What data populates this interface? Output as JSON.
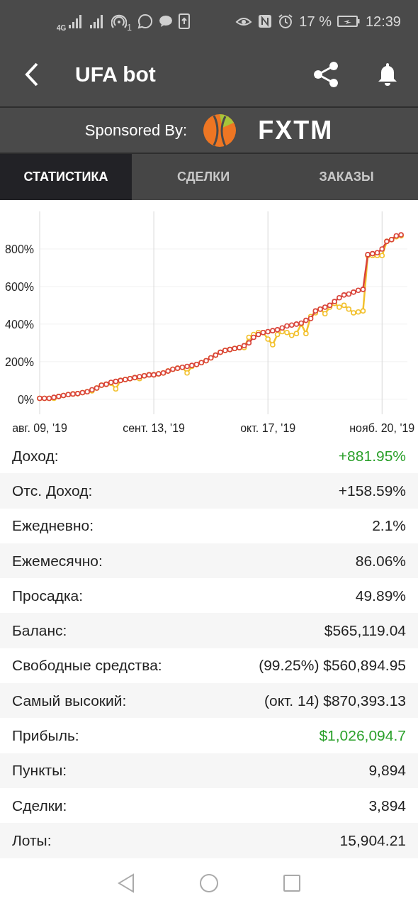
{
  "status_bar": {
    "network": "4G",
    "notification_count": "1",
    "battery": "17 %",
    "time": "12:39"
  },
  "header": {
    "title": "UFA bot"
  },
  "sponsor": {
    "label": "Sponsored By:",
    "brand": "FXTM"
  },
  "tabs": [
    {
      "label": "СТАТИСТИКА",
      "selected": true
    },
    {
      "label": "СДЕЛКИ",
      "selected": false
    },
    {
      "label": "ЗАКАЗЫ",
      "selected": false
    }
  ],
  "chart": {
    "chart_data": {
      "type": "line",
      "categories": [
        "авг. 09, '19",
        null,
        null,
        null,
        null,
        null,
        null,
        null,
        null,
        null,
        null,
        null,
        null,
        null,
        null,
        null,
        null,
        null,
        null,
        null,
        null,
        null,
        null,
        null,
        "сент. 13, '19",
        null,
        null,
        null,
        null,
        null,
        null,
        null,
        null,
        null,
        null,
        null,
        null,
        null,
        null,
        null,
        null,
        null,
        null,
        null,
        null,
        null,
        null,
        null,
        "окт. 17, '19",
        null,
        null,
        null,
        null,
        null,
        null,
        null,
        null,
        null,
        null,
        null,
        null,
        null,
        null,
        null,
        null,
        null,
        null,
        null,
        null,
        null,
        null,
        null,
        "нояб. 20, '19",
        null,
        null,
        null,
        null
      ],
      "series": [
        {
          "color": "#f2c12e",
          "marker": "circle",
          "values": [
            5,
            5,
            5,
            5,
            15,
            20,
            25,
            28,
            30,
            35,
            40,
            45,
            60,
            75,
            80,
            85,
            55,
            100,
            105,
            110,
            115,
            110,
            125,
            130,
            130,
            135,
            140,
            150,
            160,
            165,
            170,
            140,
            175,
            185,
            195,
            205,
            220,
            235,
            250,
            260,
            265,
            270,
            275,
            275,
            330,
            345,
            355,
            355,
            320,
            290,
            345,
            360,
            355,
            340,
            350,
            400,
            350,
            440,
            460,
            480,
            455,
            490,
            510,
            490,
            500,
            480,
            460,
            465,
            470,
            765,
            765,
            765,
            765,
            840,
            850,
            865,
            870
          ]
        },
        {
          "color": "#d9443a",
          "marker": "circle",
          "values": [
            5,
            5,
            5,
            10,
            15,
            20,
            25,
            28,
            30,
            35,
            40,
            50,
            60,
            75,
            80,
            90,
            95,
            100,
            105,
            110,
            115,
            120,
            125,
            130,
            130,
            135,
            140,
            150,
            160,
            165,
            170,
            175,
            180,
            185,
            195,
            205,
            220,
            235,
            250,
            260,
            265,
            270,
            275,
            285,
            300,
            330,
            345,
            355,
            360,
            365,
            370,
            380,
            390,
            395,
            400,
            405,
            420,
            430,
            470,
            480,
            490,
            500,
            520,
            540,
            555,
            560,
            570,
            580,
            585,
            770,
            775,
            780,
            800,
            840,
            850,
            870,
            875
          ]
        }
      ],
      "grid": true,
      "ylim": [
        -80,
        1000
      ],
      "yticks": [
        {
          "value": 0,
          "label": "0%"
        },
        {
          "value": 200,
          "label": "200%"
        },
        {
          "value": 400,
          "label": "400%"
        },
        {
          "value": 600,
          "label": "600%"
        },
        {
          "value": 800,
          "label": "800%"
        }
      ]
    }
  },
  "stats": [
    {
      "label": "Доход:",
      "value": "+881.95%",
      "positive": true
    },
    {
      "label": "Отс. Доход:",
      "value": "+158.59%",
      "positive": false
    },
    {
      "label": "Ежедневно:",
      "value": "2.1%",
      "positive": false
    },
    {
      "label": "Ежемесячно:",
      "value": "86.06%",
      "positive": false
    },
    {
      "label": "Просадка:",
      "value": "49.89%",
      "positive": false
    },
    {
      "label": "Баланс:",
      "value": "$565,119.04",
      "positive": false
    },
    {
      "label": "Свободные средства:",
      "value": "(99.25%) $560,894.95",
      "positive": false
    },
    {
      "label": "Самый высокий:",
      "value": "(окт. 14) $870,393.13",
      "positive": false
    },
    {
      "label": "Прибыль:",
      "value": "$1,026,094.7",
      "positive": true
    },
    {
      "label": "Пункты:",
      "value": "9,894",
      "positive": false
    },
    {
      "label": "Сделки:",
      "value": "3,894",
      "positive": false
    },
    {
      "label": "Лоты:",
      "value": "15,904.21",
      "positive": false
    }
  ]
}
